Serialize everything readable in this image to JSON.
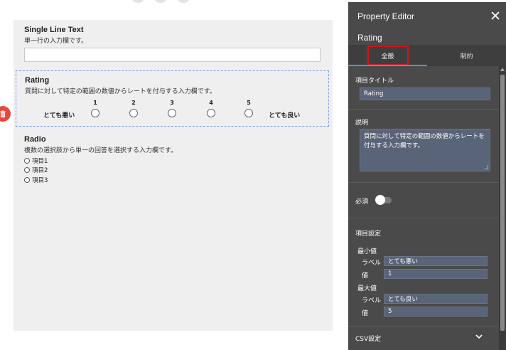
{
  "form": {
    "single": {
      "title": "Single Line Text",
      "description": "単一行の入力欄です。"
    },
    "rating": {
      "title": "Rating",
      "description": "質問に対して特定の範囲の数値からレートを付与する入力欄です。",
      "min_label": "とても悪い",
      "max_label": "とても良い",
      "options": [
        "1",
        "2",
        "3",
        "4",
        "5"
      ]
    },
    "radio": {
      "title": "Radio",
      "description": "複数の選択肢から単一の回答を選択する入力欄です。",
      "items": [
        "項目1",
        "項目2",
        "項目3"
      ]
    }
  },
  "property_editor": {
    "title": "Property Editor",
    "selected": "Rating",
    "tabs": {
      "general": "全般",
      "constraint": "制約"
    },
    "item_title_label": "項目タイトル",
    "item_title_value": "Rating",
    "description_label": "説明",
    "description_value": "質問に対して特定の範囲の数値からレートを付与する入力欄です。",
    "required_label": "必須",
    "item_settings_label": "項目設定",
    "min_heading": "最小値",
    "min_label_label": "ラベル",
    "min_label_value": "とても悪い",
    "min_value_label": "値",
    "min_value": "1",
    "max_heading": "最大値",
    "max_label_label": "ラベル",
    "max_label_value": "とても良い",
    "max_value_label": "値",
    "max_value": "5",
    "csv_label": "CSV設定"
  },
  "colors": {
    "panel_bg": "#4a4a4a",
    "field_bg": "#5a6478",
    "highlight": "#d01818",
    "delete": "#e8473a",
    "selection_border": "#7aa0e8"
  }
}
